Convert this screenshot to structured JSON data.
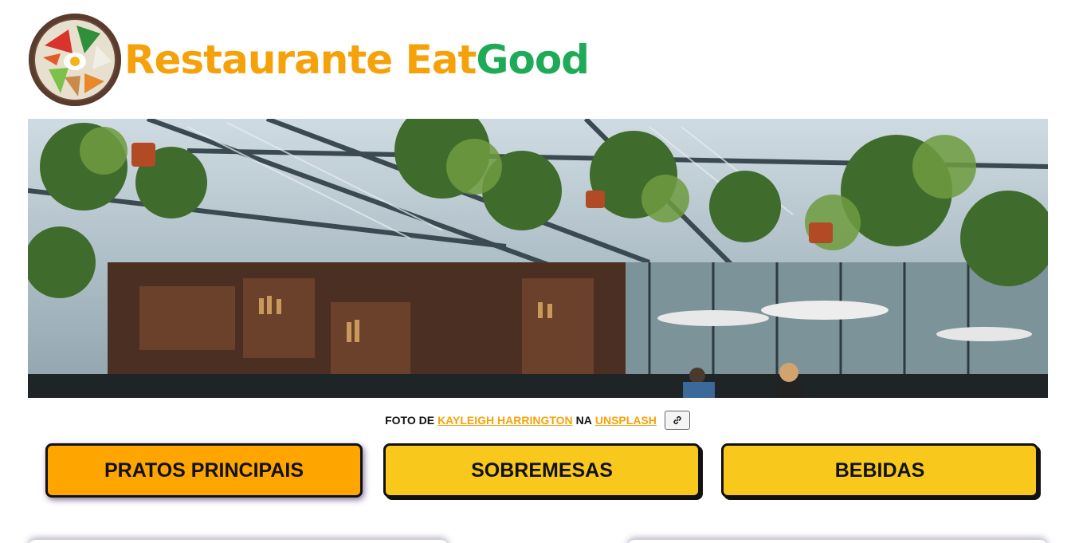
{
  "header": {
    "logo_icon": "food-plate-logo-icon",
    "brand_part1": "Restaurante Eat",
    "brand_part2": "Good",
    "colors": {
      "orange": "#f5a20a",
      "green": "#1faa57"
    }
  },
  "hero": {
    "image": "restaurant-greenhouse-interior-photo"
  },
  "credit": {
    "prefix": "FOTO DE",
    "author": "KAYLEIGH HARRINGTON",
    "middle": "NA",
    "site": "UNSPLASH",
    "link_icon": "link-icon"
  },
  "tabs": [
    {
      "label": "PRATOS PRINCIPAIS",
      "active": true
    },
    {
      "label": "SOBREMESAS",
      "active": false
    },
    {
      "label": "BEBIDAS",
      "active": false
    }
  ],
  "colors": {
    "tab_active": "#ffa500",
    "tab_inactive": "#f8c81c"
  }
}
